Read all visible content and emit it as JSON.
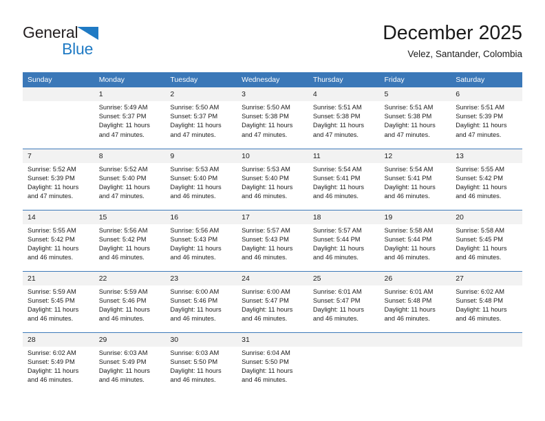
{
  "brand": {
    "name_part1": "General",
    "name_part2": "Blue",
    "triangle_color": "#1f7ac4",
    "text_color": "#231f20"
  },
  "header": {
    "title": "December 2025",
    "subtitle": "Velez, Santander, Colombia"
  },
  "theme": {
    "header_bg": "#3b78b8",
    "header_text": "#ffffff",
    "daynum_bg": "#f2f2f2",
    "cell_bg": "#ffffff",
    "row_divider": "#3b78b8"
  },
  "weekday_headers": [
    "Sunday",
    "Monday",
    "Tuesday",
    "Wednesday",
    "Thursday",
    "Friday",
    "Saturday"
  ],
  "labels": {
    "sunrise_prefix": "Sunrise: ",
    "sunset_prefix": "Sunset: ",
    "daylight_prefix": "Daylight: "
  },
  "weeks": [
    [
      {
        "day": "",
        "empty": true
      },
      {
        "day": "1",
        "sunrise": "Sunrise: 5:49 AM",
        "sunset": "Sunset: 5:37 PM",
        "daylight_line1": "Daylight: 11 hours",
        "daylight_line2": "and 47 minutes."
      },
      {
        "day": "2",
        "sunrise": "Sunrise: 5:50 AM",
        "sunset": "Sunset: 5:37 PM",
        "daylight_line1": "Daylight: 11 hours",
        "daylight_line2": "and 47 minutes."
      },
      {
        "day": "3",
        "sunrise": "Sunrise: 5:50 AM",
        "sunset": "Sunset: 5:38 PM",
        "daylight_line1": "Daylight: 11 hours",
        "daylight_line2": "and 47 minutes."
      },
      {
        "day": "4",
        "sunrise": "Sunrise: 5:51 AM",
        "sunset": "Sunset: 5:38 PM",
        "daylight_line1": "Daylight: 11 hours",
        "daylight_line2": "and 47 minutes."
      },
      {
        "day": "5",
        "sunrise": "Sunrise: 5:51 AM",
        "sunset": "Sunset: 5:38 PM",
        "daylight_line1": "Daylight: 11 hours",
        "daylight_line2": "and 47 minutes."
      },
      {
        "day": "6",
        "sunrise": "Sunrise: 5:51 AM",
        "sunset": "Sunset: 5:39 PM",
        "daylight_line1": "Daylight: 11 hours",
        "daylight_line2": "and 47 minutes."
      }
    ],
    [
      {
        "day": "7",
        "sunrise": "Sunrise: 5:52 AM",
        "sunset": "Sunset: 5:39 PM",
        "daylight_line1": "Daylight: 11 hours",
        "daylight_line2": "and 47 minutes."
      },
      {
        "day": "8",
        "sunrise": "Sunrise: 5:52 AM",
        "sunset": "Sunset: 5:40 PM",
        "daylight_line1": "Daylight: 11 hours",
        "daylight_line2": "and 47 minutes."
      },
      {
        "day": "9",
        "sunrise": "Sunrise: 5:53 AM",
        "sunset": "Sunset: 5:40 PM",
        "daylight_line1": "Daylight: 11 hours",
        "daylight_line2": "and 46 minutes."
      },
      {
        "day": "10",
        "sunrise": "Sunrise: 5:53 AM",
        "sunset": "Sunset: 5:40 PM",
        "daylight_line1": "Daylight: 11 hours",
        "daylight_line2": "and 46 minutes."
      },
      {
        "day": "11",
        "sunrise": "Sunrise: 5:54 AM",
        "sunset": "Sunset: 5:41 PM",
        "daylight_line1": "Daylight: 11 hours",
        "daylight_line2": "and 46 minutes."
      },
      {
        "day": "12",
        "sunrise": "Sunrise: 5:54 AM",
        "sunset": "Sunset: 5:41 PM",
        "daylight_line1": "Daylight: 11 hours",
        "daylight_line2": "and 46 minutes."
      },
      {
        "day": "13",
        "sunrise": "Sunrise: 5:55 AM",
        "sunset": "Sunset: 5:42 PM",
        "daylight_line1": "Daylight: 11 hours",
        "daylight_line2": "and 46 minutes."
      }
    ],
    [
      {
        "day": "14",
        "sunrise": "Sunrise: 5:55 AM",
        "sunset": "Sunset: 5:42 PM",
        "daylight_line1": "Daylight: 11 hours",
        "daylight_line2": "and 46 minutes."
      },
      {
        "day": "15",
        "sunrise": "Sunrise: 5:56 AM",
        "sunset": "Sunset: 5:42 PM",
        "daylight_line1": "Daylight: 11 hours",
        "daylight_line2": "and 46 minutes."
      },
      {
        "day": "16",
        "sunrise": "Sunrise: 5:56 AM",
        "sunset": "Sunset: 5:43 PM",
        "daylight_line1": "Daylight: 11 hours",
        "daylight_line2": "and 46 minutes."
      },
      {
        "day": "17",
        "sunrise": "Sunrise: 5:57 AM",
        "sunset": "Sunset: 5:43 PM",
        "daylight_line1": "Daylight: 11 hours",
        "daylight_line2": "and 46 minutes."
      },
      {
        "day": "18",
        "sunrise": "Sunrise: 5:57 AM",
        "sunset": "Sunset: 5:44 PM",
        "daylight_line1": "Daylight: 11 hours",
        "daylight_line2": "and 46 minutes."
      },
      {
        "day": "19",
        "sunrise": "Sunrise: 5:58 AM",
        "sunset": "Sunset: 5:44 PM",
        "daylight_line1": "Daylight: 11 hours",
        "daylight_line2": "and 46 minutes."
      },
      {
        "day": "20",
        "sunrise": "Sunrise: 5:58 AM",
        "sunset": "Sunset: 5:45 PM",
        "daylight_line1": "Daylight: 11 hours",
        "daylight_line2": "and 46 minutes."
      }
    ],
    [
      {
        "day": "21",
        "sunrise": "Sunrise: 5:59 AM",
        "sunset": "Sunset: 5:45 PM",
        "daylight_line1": "Daylight: 11 hours",
        "daylight_line2": "and 46 minutes."
      },
      {
        "day": "22",
        "sunrise": "Sunrise: 5:59 AM",
        "sunset": "Sunset: 5:46 PM",
        "daylight_line1": "Daylight: 11 hours",
        "daylight_line2": "and 46 minutes."
      },
      {
        "day": "23",
        "sunrise": "Sunrise: 6:00 AM",
        "sunset": "Sunset: 5:46 PM",
        "daylight_line1": "Daylight: 11 hours",
        "daylight_line2": "and 46 minutes."
      },
      {
        "day": "24",
        "sunrise": "Sunrise: 6:00 AM",
        "sunset": "Sunset: 5:47 PM",
        "daylight_line1": "Daylight: 11 hours",
        "daylight_line2": "and 46 minutes."
      },
      {
        "day": "25",
        "sunrise": "Sunrise: 6:01 AM",
        "sunset": "Sunset: 5:47 PM",
        "daylight_line1": "Daylight: 11 hours",
        "daylight_line2": "and 46 minutes."
      },
      {
        "day": "26",
        "sunrise": "Sunrise: 6:01 AM",
        "sunset": "Sunset: 5:48 PM",
        "daylight_line1": "Daylight: 11 hours",
        "daylight_line2": "and 46 minutes."
      },
      {
        "day": "27",
        "sunrise": "Sunrise: 6:02 AM",
        "sunset": "Sunset: 5:48 PM",
        "daylight_line1": "Daylight: 11 hours",
        "daylight_line2": "and 46 minutes."
      }
    ],
    [
      {
        "day": "28",
        "sunrise": "Sunrise: 6:02 AM",
        "sunset": "Sunset: 5:49 PM",
        "daylight_line1": "Daylight: 11 hours",
        "daylight_line2": "and 46 minutes."
      },
      {
        "day": "29",
        "sunrise": "Sunrise: 6:03 AM",
        "sunset": "Sunset: 5:49 PM",
        "daylight_line1": "Daylight: 11 hours",
        "daylight_line2": "and 46 minutes."
      },
      {
        "day": "30",
        "sunrise": "Sunrise: 6:03 AM",
        "sunset": "Sunset: 5:50 PM",
        "daylight_line1": "Daylight: 11 hours",
        "daylight_line2": "and 46 minutes."
      },
      {
        "day": "31",
        "sunrise": "Sunrise: 6:04 AM",
        "sunset": "Sunset: 5:50 PM",
        "daylight_line1": "Daylight: 11 hours",
        "daylight_line2": "and 46 minutes."
      },
      {
        "day": "",
        "empty": true
      },
      {
        "day": "",
        "empty": true
      },
      {
        "day": "",
        "empty": true
      }
    ]
  ]
}
